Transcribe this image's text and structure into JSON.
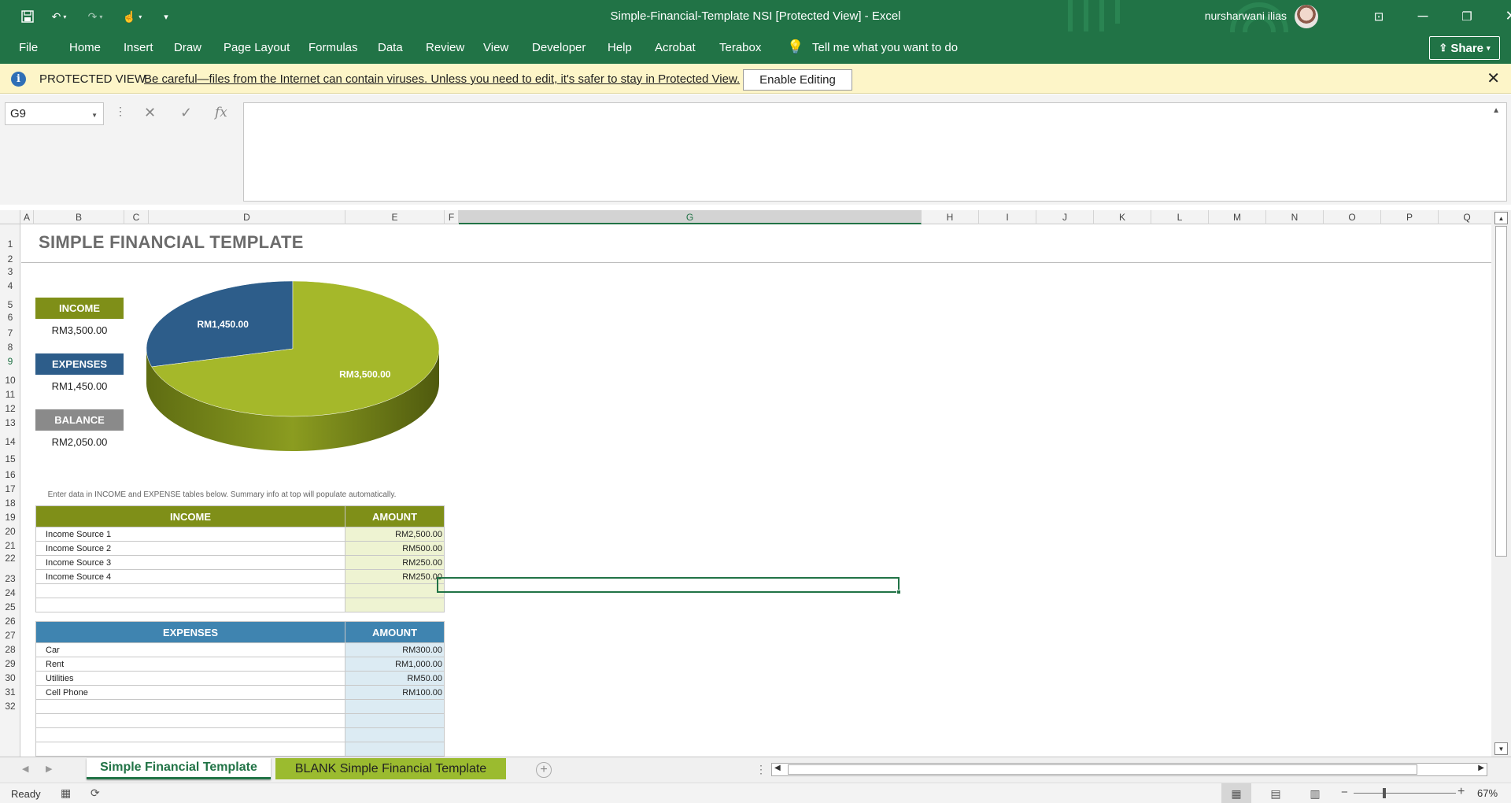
{
  "titlebar": {
    "doc_title": "Simple-Financial-Template NSI  [Protected View]  -  Excel",
    "user_name": "nursharwani ilias"
  },
  "menu": {
    "items": [
      "File",
      "Home",
      "Insert",
      "Draw",
      "Page Layout",
      "Formulas",
      "Data",
      "Review",
      "View",
      "Developer",
      "Help",
      "Acrobat",
      "Terabox"
    ],
    "tell_me": "Tell me what you want to do",
    "share_label": "Share"
  },
  "protected_view": {
    "title": "PROTECTED VIEW",
    "message": "Be careful—files from the Internet can contain viruses. Unless you need to edit, it's safer to stay in Protected View.",
    "enable_button": "Enable Editing"
  },
  "formula_bar": {
    "name_box": "G9",
    "content": ""
  },
  "grid": {
    "columns": [
      "A",
      "B",
      "C",
      "D",
      "E",
      "F",
      "G",
      "H",
      "I",
      "J",
      "K",
      "L",
      "M",
      "N",
      "O",
      "P",
      "Q"
    ],
    "selected_column": "G",
    "rows": [
      "1",
      "2",
      "3",
      "4",
      "5",
      "6",
      "7",
      "8",
      "9",
      "10",
      "11",
      "12",
      "13",
      "14",
      "15",
      "16",
      "17",
      "18",
      "19",
      "20",
      "21",
      "22",
      "23",
      "24",
      "25",
      "26",
      "27",
      "28",
      "29",
      "30",
      "31",
      "32"
    ],
    "selected_row": "9"
  },
  "sheet": {
    "title": "SIMPLE FINANCIAL TEMPLATE",
    "summary": {
      "income_label": "INCOME",
      "income_value": "RM3,500.00",
      "expenses_label": "EXPENSES",
      "expenses_value": "RM1,450.00",
      "balance_label": "BALANCE",
      "balance_value": "RM2,050.00"
    },
    "hint": "Enter data in INCOME and EXPENSE tables below. Summary info at top will populate automatically.",
    "income_table": {
      "header": "INCOME",
      "amount_header": "AMOUNT",
      "rows": [
        {
          "name": "Income Source 1",
          "amount": "RM2,500.00"
        },
        {
          "name": "Income Source 2",
          "amount": "RM500.00"
        },
        {
          "name": "Income Source 3",
          "amount": "RM250.00"
        },
        {
          "name": "Income Source 4",
          "amount": "RM250.00"
        },
        {
          "name": "",
          "amount": ""
        },
        {
          "name": "",
          "amount": ""
        }
      ]
    },
    "expenses_table": {
      "header": "EXPENSES",
      "amount_header": "AMOUNT",
      "rows": [
        {
          "name": "Car",
          "amount": "RM300.00"
        },
        {
          "name": "Rent",
          "amount": "RM1,000.00"
        },
        {
          "name": "Utilities",
          "amount": "RM50.00"
        },
        {
          "name": "Cell Phone",
          "amount": "RM100.00"
        },
        {
          "name": "",
          "amount": ""
        },
        {
          "name": "",
          "amount": ""
        },
        {
          "name": "",
          "amount": ""
        },
        {
          "name": "",
          "amount": ""
        },
        {
          "name": "",
          "amount": ""
        }
      ]
    }
  },
  "chart_data": {
    "type": "pie",
    "categories": [
      "Expenses",
      "Income"
    ],
    "values": [
      1450,
      3500
    ],
    "labels": [
      "RM1,450.00",
      "RM3,500.00"
    ],
    "colors": [
      "#2d5d8a",
      "#a5b82a"
    ]
  },
  "sheet_tabs": {
    "tabs": [
      "Simple Financial Template",
      "BLANK Simple Financial Template"
    ],
    "active": "Simple Financial Template"
  },
  "status": {
    "text": "Ready",
    "zoom": "67%",
    "zoom_level": 0.67
  },
  "colors": {
    "excel_green": "#217346",
    "income_olive": "#7f8f18",
    "expenses_blue": "#2d5d8a",
    "balance_gray": "#8a8a8a"
  }
}
